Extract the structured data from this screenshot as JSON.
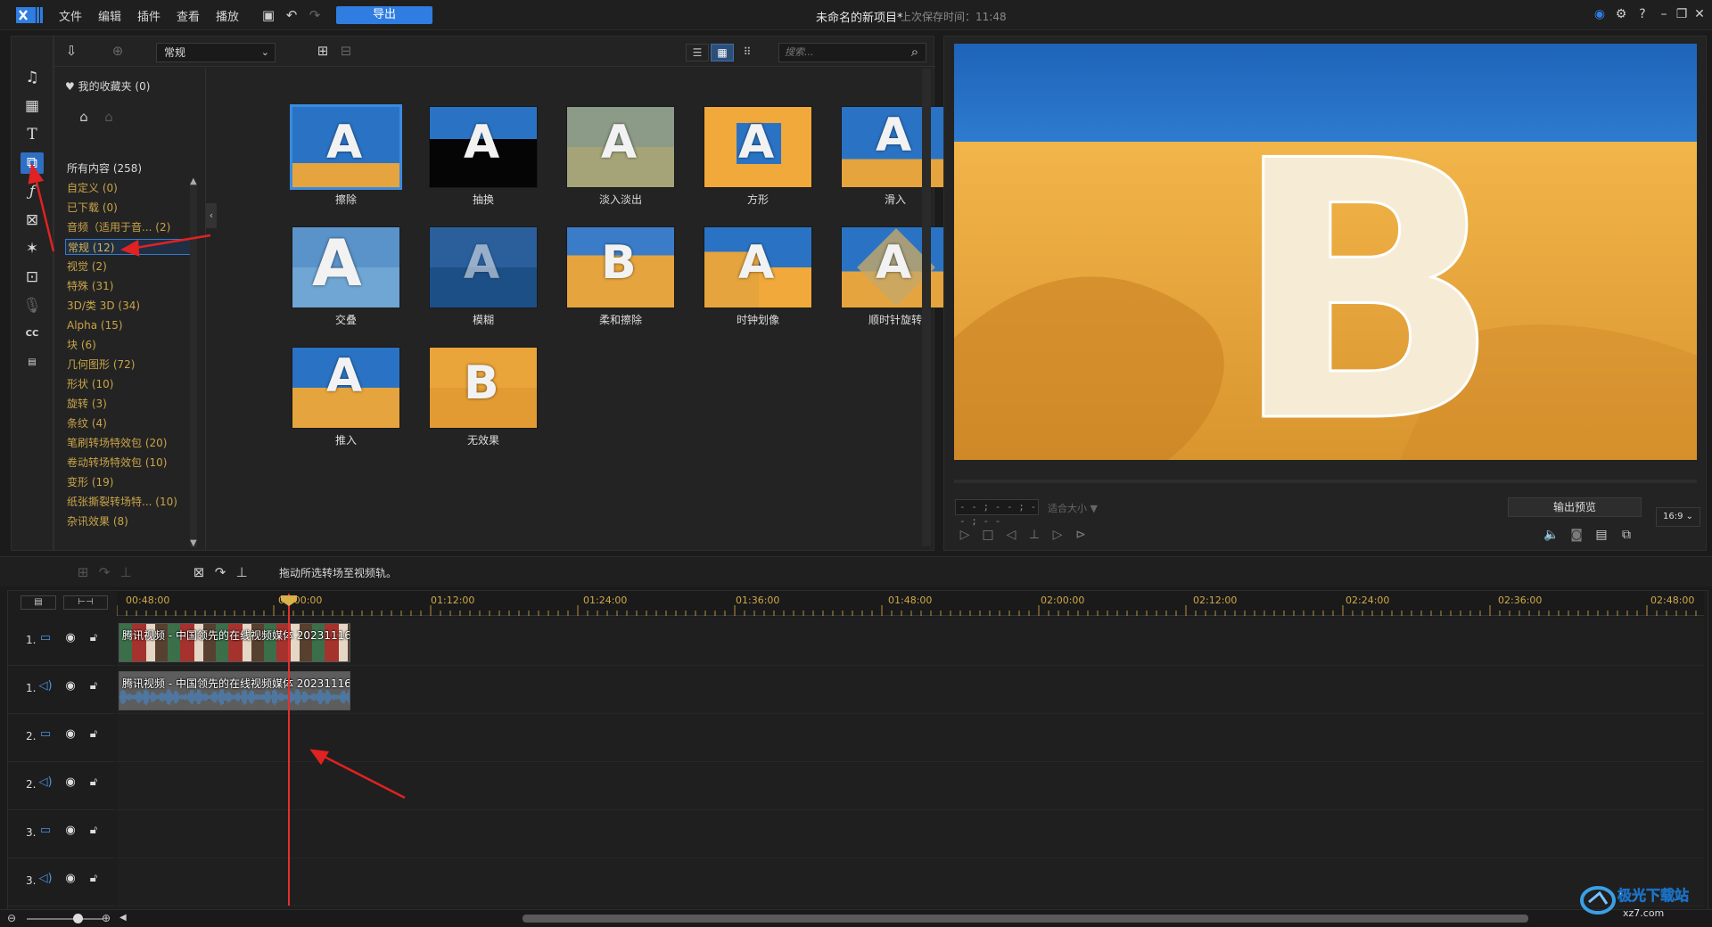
{
  "titlebar": {
    "menus": [
      "文件",
      "编辑",
      "插件",
      "查看",
      "播放"
    ],
    "export_label": "导出",
    "project_title": "未命名的新项目*",
    "last_saved": "上次保存时间：11:48"
  },
  "rail": {
    "icons": [
      "media-icon",
      "video-icon",
      "text-icon",
      "transition-icon",
      "effect-icon",
      "pip-icon",
      "particle-icon",
      "title-icon",
      "voice-icon",
      "subtitle-icon",
      "chapter-icon"
    ]
  },
  "library": {
    "category_select": "常规",
    "search_placeholder": "搜索...",
    "favorites": "我的收藏夹 (0)",
    "all_content": "所有内容 (258)",
    "categories": [
      {
        "label": "自定义  (0)"
      },
      {
        "label": "已下载  (0)"
      },
      {
        "label": "音频（适用于音...  (2)"
      },
      {
        "label": "常规  (12)",
        "selected": true
      },
      {
        "label": "视觉  (2)"
      },
      {
        "label": "特殊  (31)"
      },
      {
        "label": "3D/类 3D  (34)"
      },
      {
        "label": "Alpha  (15)"
      },
      {
        "label": "块  (6)"
      },
      {
        "label": "几何图形  (72)"
      },
      {
        "label": "形状  (10)"
      },
      {
        "label": "旋转  (3)"
      },
      {
        "label": "条纹  (4)"
      },
      {
        "label": "笔刷转场特效包  (20)"
      },
      {
        "label": "卷动转场特效包  (10)"
      },
      {
        "label": "变形  (19)"
      },
      {
        "label": "纸张撕裂转场特...  (10)"
      },
      {
        "label": "杂讯效果  (8)"
      }
    ],
    "transitions": [
      {
        "label": "擦除",
        "letter": "A",
        "style": "blue-desert",
        "selected": true
      },
      {
        "label": "抽换",
        "letter": "A",
        "style": "blue-black"
      },
      {
        "label": "淡入淡出",
        "letter": "A",
        "style": "fade"
      },
      {
        "label": "方形",
        "letter": "A",
        "style": "square"
      },
      {
        "label": "滑入",
        "letter": "A",
        "style": "slide"
      },
      {
        "label": "交叠",
        "letter": "A",
        "style": "overlap"
      },
      {
        "label": "模糊",
        "letter": "A",
        "style": "blur"
      },
      {
        "label": "柔和擦除",
        "letter": "B",
        "style": "soft"
      },
      {
        "label": "时钟划像",
        "letter": "A",
        "style": "clock"
      },
      {
        "label": "顺时针旋转",
        "letter": "A",
        "style": "rotate"
      },
      {
        "label": "推入",
        "letter": "A",
        "style": "push"
      },
      {
        "label": "无效果",
        "letter": "B",
        "style": "none"
      }
    ]
  },
  "preview": {
    "letter": "B",
    "timecode": "- - ; - - ; - - ; - -",
    "fit_size": "适合大小 ▼",
    "output_preview": "输出预览",
    "ratio": "16:9"
  },
  "timeline": {
    "hint": "拖动所选转场至视频轨。",
    "ticks": [
      "00:48:00",
      "01:00:00",
      "01:12:00",
      "01:24:00",
      "01:36:00",
      "01:48:00",
      "02:00:00",
      "02:12:00",
      "02:24:00",
      "02:36:00",
      "02:48:00"
    ],
    "tracks": [
      {
        "num": "1.",
        "type": "video"
      },
      {
        "num": "1.",
        "type": "audio"
      },
      {
        "num": "2.",
        "type": "video"
      },
      {
        "num": "2.",
        "type": "audio"
      },
      {
        "num": "3.",
        "type": "video"
      },
      {
        "num": "3.",
        "type": "audio"
      }
    ],
    "clip_title": "腾讯视频 - 中国领先的在线视频媒体 20231116"
  },
  "watermark": {
    "text": "极光下载站",
    "sub": "xz7.com"
  },
  "colors": {
    "accent": "#2f7de1",
    "category_text": "#c9a449",
    "sky": "#2a73c4",
    "desert": "#e5a43d",
    "playhead": "#e23030"
  }
}
